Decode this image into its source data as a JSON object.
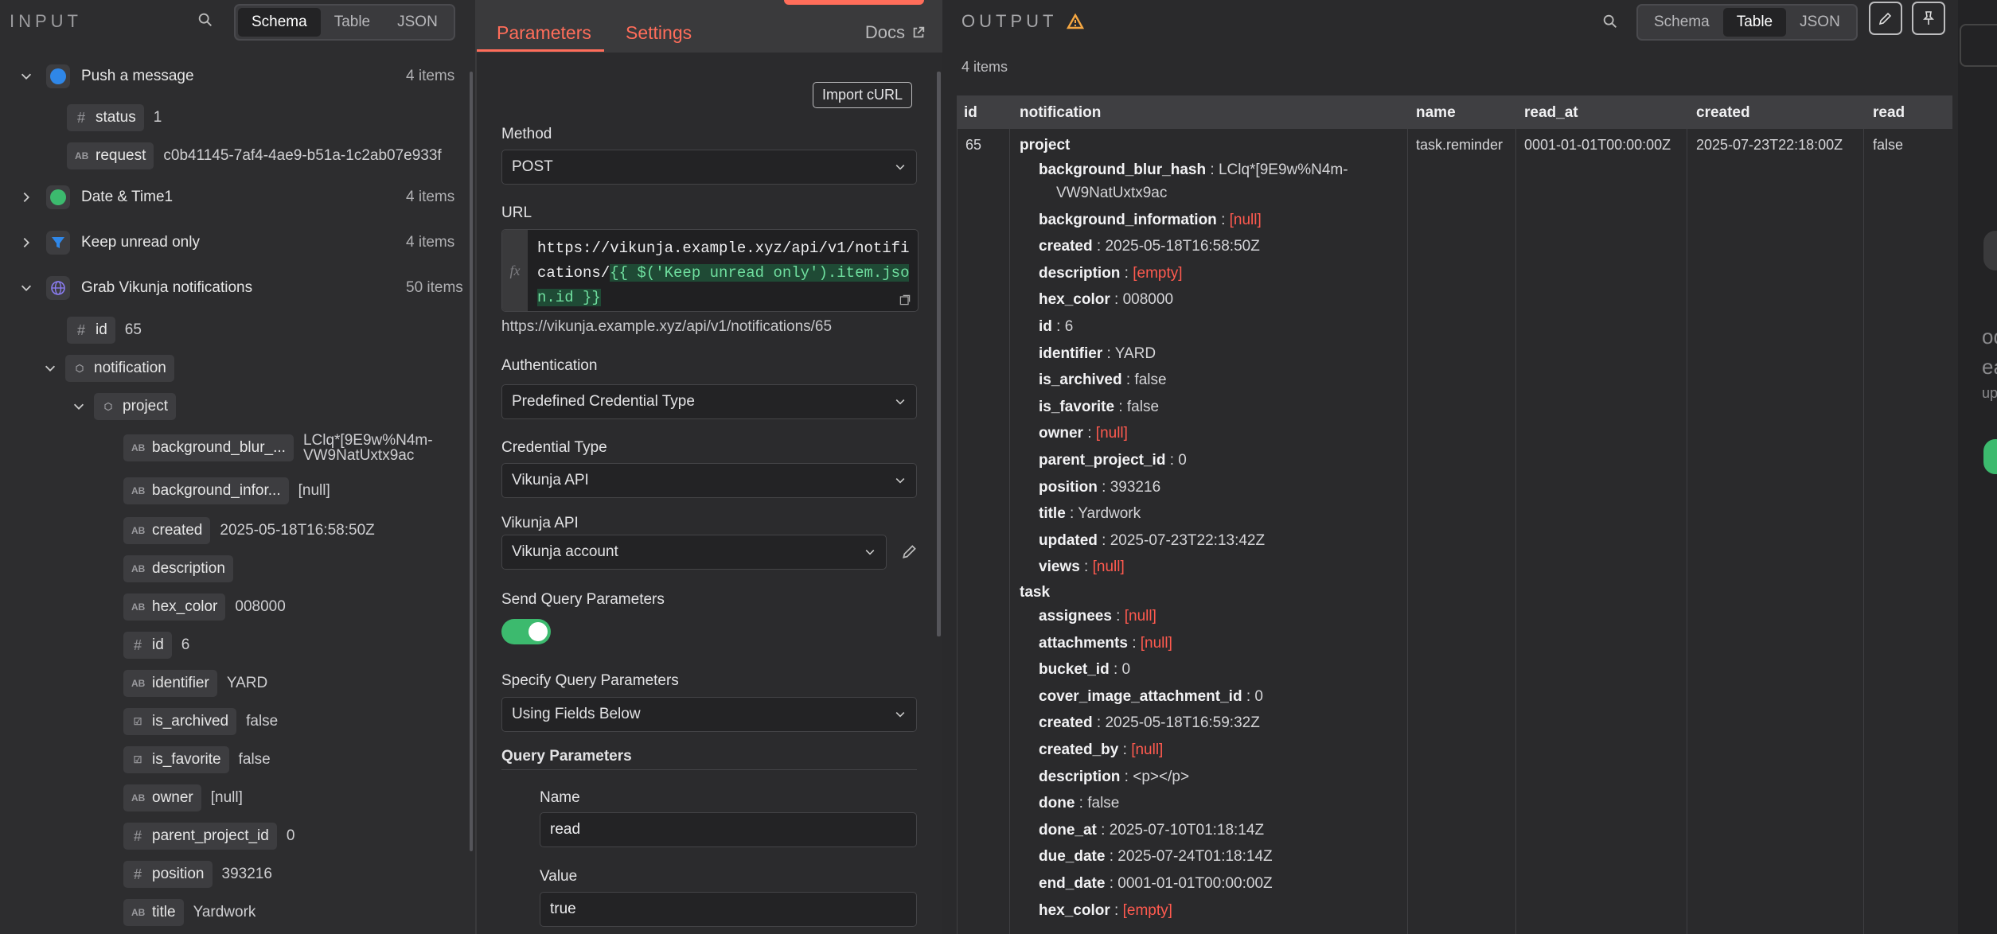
{
  "input": {
    "title": "INPUT",
    "view_tabs": [
      "Schema",
      "Table",
      "JSON"
    ],
    "nodes": [
      {
        "label": "Push a message",
        "count": "4 items"
      },
      {
        "label": "Date & Time1",
        "count": "4 items"
      },
      {
        "label": "Keep unread only",
        "count": "4 items"
      },
      {
        "label": "Grab Vikunja notifications",
        "count": "50 items"
      }
    ],
    "push_fields": [
      {
        "key": "status",
        "value": "1"
      },
      {
        "key": "request",
        "value": "c0b41145-7af4-4ae9-b51a-1c2ab07e933f"
      }
    ],
    "grab_fields": {
      "id_key": "id",
      "id_value": "65",
      "notification_key": "notification",
      "project_key": "project",
      "project_fields": [
        {
          "key": "background_blur_...",
          "value": "LClq*[9E9w%N4m-VW9NatUxtx9ac"
        },
        {
          "key": "background_infor...",
          "value": "[null]"
        },
        {
          "key": "created",
          "value": "2025-05-18T16:58:50Z"
        },
        {
          "key": "description",
          "value": ""
        },
        {
          "key": "hex_color",
          "value": "008000"
        },
        {
          "key": "id",
          "value": "6"
        },
        {
          "key": "identifier",
          "value": "YARD"
        },
        {
          "key": "is_archived",
          "value": "false"
        },
        {
          "key": "is_favorite",
          "value": "false"
        },
        {
          "key": "owner",
          "value": "[null]"
        },
        {
          "key": "parent_project_id",
          "value": "0"
        },
        {
          "key": "position",
          "value": "393216"
        },
        {
          "key": "title",
          "value": "Yardwork"
        }
      ]
    }
  },
  "params": {
    "tabs": [
      "Parameters",
      "Settings"
    ],
    "docs_label": "Docs",
    "import_curl": "Import cURL",
    "method_label": "Method",
    "method_value": "POST",
    "url_label": "URL",
    "url_plain": "https://vikunja.example.xyz/api/v1/notifications/",
    "url_expr": "{{ $('Keep unread only').item.json.id }}",
    "url_preview": "https://vikunja.example.xyz/api/v1/notifications/65",
    "auth_label": "Authentication",
    "auth_value": "Predefined Credential Type",
    "cred_type_label": "Credential Type",
    "cred_type_value": "Vikunja API",
    "vikunja_label": "Vikunja API",
    "vikunja_value": "Vikunja account",
    "send_query_label": "Send Query Parameters",
    "send_query_on": true,
    "specify_label": "Specify Query Parameters",
    "specify_value": "Using Fields Below",
    "query_params_label": "Query Parameters",
    "qp_name_label": "Name",
    "qp_name_value": "read",
    "qp_value_label": "Value",
    "qp_value_value": "true"
  },
  "output": {
    "title": "OUTPUT",
    "view_tabs": [
      "Schema",
      "Table",
      "JSON"
    ],
    "item_count": "4 items",
    "columns": [
      "id",
      "notification",
      "name",
      "read_at",
      "created",
      "read"
    ],
    "row": {
      "id": "65",
      "name": "task.reminder",
      "read_at": "0001-01-01T00:00:00Z",
      "created": "2025-07-23T22:18:00Z",
      "read": "false"
    },
    "project_label": "project",
    "project_kv": [
      {
        "k": "background_blur_hash",
        "v": "LClq*[9E9w%N4m-",
        "null": false
      },
      {
        "k": "background_information",
        "v": "[null]",
        "null": true
      },
      {
        "k": "created",
        "v": "2025-05-18T16:58:50Z",
        "null": false
      },
      {
        "k": "description",
        "v": "[empty]",
        "null": true
      },
      {
        "k": "hex_color",
        "v": "008000",
        "null": false
      },
      {
        "k": "id",
        "v": "6",
        "null": false
      },
      {
        "k": "identifier",
        "v": "YARD",
        "null": false
      },
      {
        "k": "is_archived",
        "v": "false",
        "null": false
      },
      {
        "k": "is_favorite",
        "v": "false",
        "null": false
      },
      {
        "k": "owner",
        "v": "[null]",
        "null": true
      },
      {
        "k": "parent_project_id",
        "v": "0",
        "null": false
      },
      {
        "k": "position",
        "v": "393216",
        "null": false
      },
      {
        "k": "title",
        "v": "Yardwork",
        "null": false
      },
      {
        "k": "updated",
        "v": "2025-07-23T22:13:42Z",
        "null": false
      },
      {
        "k": "views",
        "v": "[null]",
        "null": true
      }
    ],
    "blur_hash_cont": "VW9NatUxtx9ac",
    "task_label": "task",
    "task_kv": [
      {
        "k": "assignees",
        "v": "[null]",
        "null": true
      },
      {
        "k": "attachments",
        "v": "[null]",
        "null": true
      },
      {
        "k": "bucket_id",
        "v": "0",
        "null": false
      },
      {
        "k": "cover_image_attachment_id",
        "v": "0",
        "null": false
      },
      {
        "k": "created",
        "v": "2025-05-18T16:59:32Z",
        "null": false
      },
      {
        "k": "created_by",
        "v": "[null]",
        "null": true
      },
      {
        "k": "description",
        "v": "<p></p>",
        "null": false
      },
      {
        "k": "done",
        "v": "false",
        "null": false
      },
      {
        "k": "done_at",
        "v": "2025-07-10T01:18:14Z",
        "null": false
      },
      {
        "k": "due_date",
        "v": "2025-07-24T01:18:14Z",
        "null": false
      },
      {
        "k": "end_date",
        "v": "0001-01-01T00:00:00Z",
        "null": false
      },
      {
        "k": "hex_color",
        "v": "[empty]",
        "null": true
      }
    ]
  },
  "edge": {
    "fragments": [
      "oda",
      "ea",
      "upd"
    ]
  },
  "colors": {
    "accent": "#ff6d5a",
    "toggle": "#3cba6e",
    "null": "#ff5a4f",
    "expr_bg": "#1f4a35",
    "expr_fg": "#6fdf9f"
  }
}
